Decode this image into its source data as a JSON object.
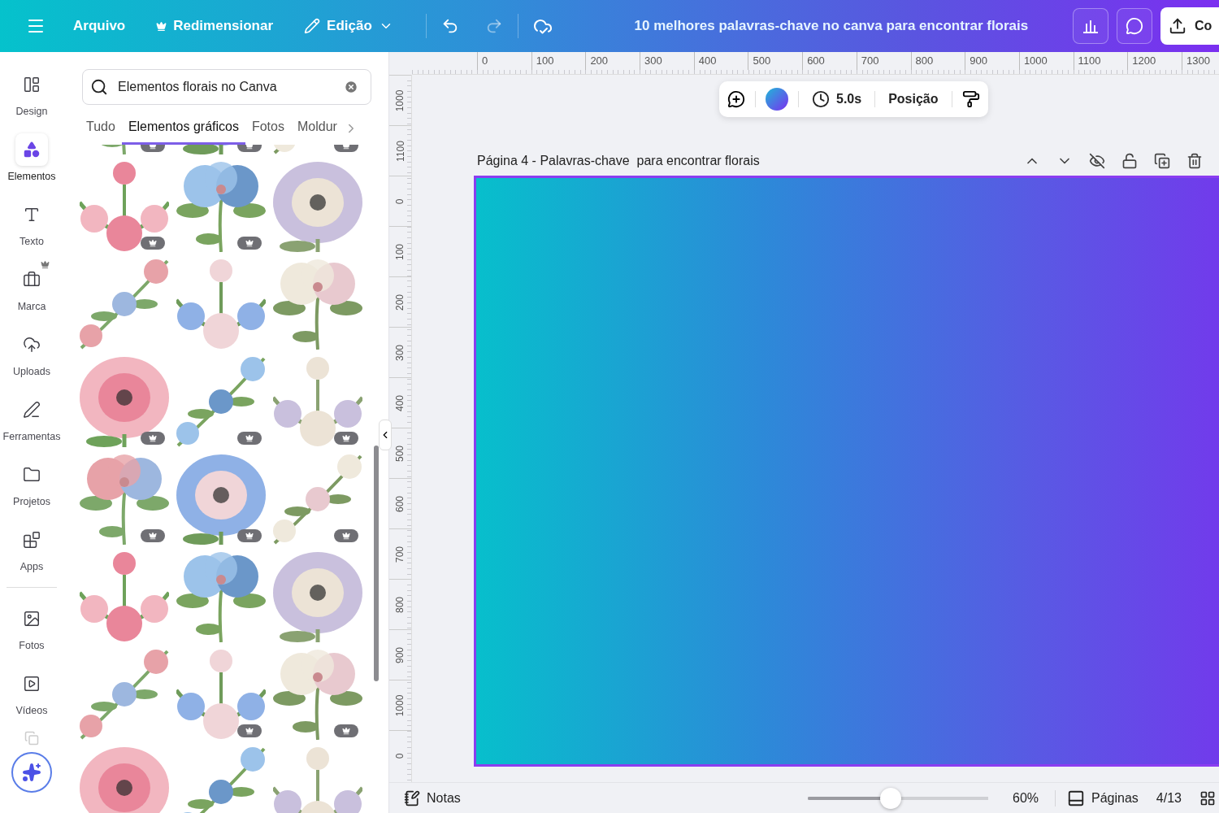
{
  "top_bar": {
    "menu": [
      {
        "label": "Arquivo",
        "kind": "plain"
      },
      {
        "label": "Redimensionar",
        "kind": "premium"
      },
      {
        "label": "Edição",
        "kind": "dropdown"
      }
    ],
    "title": "10 melhores palavras-chave no canva para encontrar florais",
    "share_button": "Co"
  },
  "sidebar": {
    "items": [
      {
        "label": "Design",
        "selected": false
      },
      {
        "label": "Elementos",
        "selected": true
      },
      {
        "label": "Texto",
        "selected": false
      },
      {
        "label": "Marca",
        "selected": false
      },
      {
        "label": "Uploads",
        "selected": false
      },
      {
        "label": "Ferramentas",
        "selected": false
      },
      {
        "label": "Projetos",
        "selected": false
      },
      {
        "label": "Apps",
        "selected": false
      }
    ],
    "extra_items": [
      {
        "label": "Fotos",
        "selected": false
      },
      {
        "label": "Vídeos",
        "selected": false
      }
    ]
  },
  "panel": {
    "search": {
      "value": "Elementos florais no Canva"
    },
    "tabs": [
      {
        "label": "Tudo",
        "selected": false
      },
      {
        "label": "Elementos gráficos",
        "selected": true
      },
      {
        "label": "Fotos",
        "selected": false
      },
      {
        "label": "Moldur",
        "selected": false
      }
    ],
    "results": [
      {
        "kind": "picture",
        "premium": true
      },
      {
        "kind": "picture",
        "premium": true
      },
      {
        "kind": "picture",
        "premium": true
      },
      {
        "kind": "picture",
        "premium": true
      },
      {
        "kind": "picture",
        "premium": true
      },
      {
        "kind": "picture",
        "premium": false
      },
      {
        "kind": "picture",
        "premium": false
      },
      {
        "kind": "picture",
        "premium": false
      },
      {
        "kind": "picture",
        "premium": false
      },
      {
        "kind": "picture",
        "premium": true
      },
      {
        "kind": "picture",
        "premium": true
      },
      {
        "kind": "picture",
        "premium": true
      },
      {
        "kind": "picture",
        "premium": true
      },
      {
        "kind": "picture",
        "premium": true
      },
      {
        "kind": "picture",
        "premium": true
      },
      {
        "kind": "picture",
        "premium": false
      },
      {
        "kind": "picture",
        "premium": false
      },
      {
        "kind": "picture",
        "premium": false
      },
      {
        "kind": "picture",
        "premium": false
      },
      {
        "kind": "picture",
        "premium": true
      },
      {
        "kind": "picture",
        "premium": true
      },
      {
        "kind": "picture"
      },
      {
        "kind": "picture"
      },
      {
        "kind": "picture"
      }
    ]
  },
  "rulers": {
    "horizontal": [
      "0",
      "100",
      "200",
      "300",
      "400",
      "500",
      "600",
      "700",
      "800",
      "900",
      "1000",
      "1100",
      "1200",
      "1300"
    ],
    "vertical": [
      "1000",
      "1100",
      "0",
      "100",
      "200",
      "300",
      "400",
      "500",
      "600",
      "700",
      "800",
      "900",
      "1000",
      "0"
    ]
  },
  "floating_toolbar": {
    "duration": "5.0s",
    "position": "Posição"
  },
  "page": {
    "title": "Página 4 - Palavras-chave  para encontrar florais",
    "selected": true
  },
  "bottom_bar": {
    "notes": "Notas",
    "zoom": {
      "level": 0.46,
      "reading": "60%"
    },
    "pages": "Páginas",
    "page_count": "4/13"
  }
}
